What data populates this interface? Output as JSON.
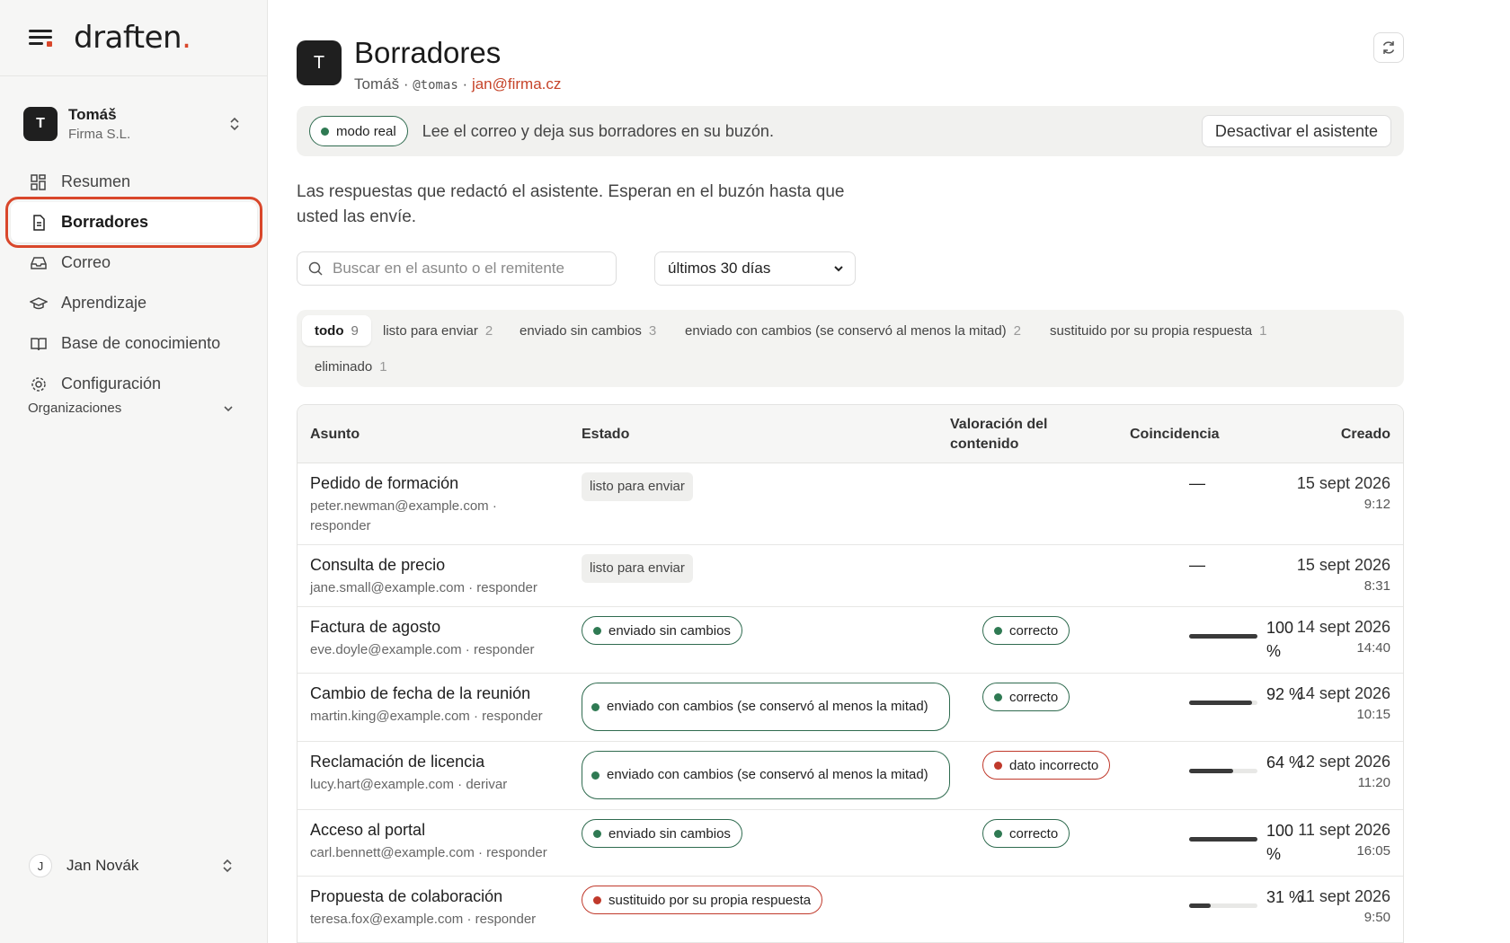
{
  "brand": {
    "logo_text": "draften",
    "logo_dot": "."
  },
  "org": {
    "avatar": "T",
    "name": "Tomáš",
    "company": "Firma S.L."
  },
  "nav": [
    {
      "label": "Resumen",
      "icon": "grid-icon"
    },
    {
      "label": "Borradores",
      "icon": "document-icon"
    },
    {
      "label": "Correo",
      "icon": "inbox-icon"
    },
    {
      "label": "Aprendizaje",
      "icon": "graduation-cap-icon"
    },
    {
      "label": "Base de conocimiento",
      "icon": "book-icon"
    },
    {
      "label": "Configuración",
      "icon": "gear-icon"
    }
  ],
  "sidebar_section": "Organizaciones",
  "user": {
    "avatar": "J",
    "name": "Jan Novák"
  },
  "header": {
    "avatar": "T",
    "title": "Borradores",
    "name": "Tomáš",
    "sep": "·",
    "handle": "@tomas",
    "email": "jan@firma.cz"
  },
  "banner": {
    "mode_label": "modo real",
    "text": "Lee el correo y deja sus borradores en su buzón.",
    "deactivate_label": "Desactivar el asistente"
  },
  "description": "Las respuestas que redactó el asistente. Esperan en el buzón hasta que usted las envíe.",
  "search": {
    "placeholder": "Buscar en el asunto o el remitente"
  },
  "period": {
    "selected": "últimos 30 días"
  },
  "filters": [
    {
      "label": "todo",
      "count": "9"
    },
    {
      "label": "listo para enviar",
      "count": "2"
    },
    {
      "label": "enviado sin cambios",
      "count": "3"
    },
    {
      "label": "enviado con cambios (se conservó al menos la mitad)",
      "count": "2"
    },
    {
      "label": "sustituido por su propia respuesta",
      "count": "1"
    },
    {
      "label": "eliminado",
      "count": "1"
    }
  ],
  "table": {
    "headers": {
      "subject": "Asunto",
      "status": "Estado",
      "rating_line1": "Valoración del",
      "rating_line2": "contenido",
      "match": "Coincidencia",
      "created": "Creado"
    },
    "rows": [
      {
        "subject": "Pedido de formación",
        "meta": "peter.newman@example.com · responder",
        "status": "listo para enviar",
        "status_kind": "grey",
        "rating": "",
        "rating_kind": "",
        "match": "—",
        "match_pct": null,
        "date": "15 sept 2026",
        "time": "9:12"
      },
      {
        "subject": "Consulta de precio",
        "meta": "jane.small@example.com · responder",
        "status": "listo para enviar",
        "status_kind": "grey",
        "rating": "",
        "rating_kind": "",
        "match": "—",
        "match_pct": null,
        "date": "15 sept 2026",
        "time": "8:31"
      },
      {
        "subject": "Factura de agosto",
        "meta": "eve.doyle@example.com · responder",
        "status": "enviado sin cambios",
        "status_kind": "green",
        "rating": "correcto",
        "rating_kind": "green",
        "match": "100 %",
        "match_pct": 1.0,
        "date": "14 sept 2026",
        "time": "14:40"
      },
      {
        "subject": "Cambio de fecha de la reunión",
        "meta": "martin.king@example.com · responder",
        "status": "enviado con cambios (se conservó al menos la mitad)",
        "status_kind": "green",
        "rating": "correcto",
        "rating_kind": "green",
        "match": "92 %",
        "match_pct": 0.92,
        "date": "14 sept 2026",
        "time": "10:15"
      },
      {
        "subject": "Reclamación de licencia",
        "meta": "lucy.hart@example.com · derivar",
        "status": "enviado con cambios (se conservó al menos la mitad)",
        "status_kind": "green",
        "rating": "dato incorrecto",
        "rating_kind": "red",
        "match": "64 %",
        "match_pct": 0.64,
        "date": "12 sept 2026",
        "time": "11:20"
      },
      {
        "subject": "Acceso al portal",
        "meta": "carl.bennett@example.com · responder",
        "status": "enviado sin cambios",
        "status_kind": "green",
        "rating": "correcto",
        "rating_kind": "green",
        "match": "100 %",
        "match_pct": 1.0,
        "date": "11 sept 2026",
        "time": "16:05"
      },
      {
        "subject": "Propuesta de colaboración",
        "meta": "teresa.fox@example.com · responder",
        "status": "sustituido por su propia respuesta",
        "status_kind": "red",
        "rating": "",
        "rating_kind": "",
        "match": "31 %",
        "match_pct": 0.31,
        "date": "11 sept 2026",
        "time": "9:50"
      }
    ]
  },
  "colors": {
    "accent": "#d9472b",
    "green": "#2f6b4f",
    "red": "#c0392b"
  }
}
